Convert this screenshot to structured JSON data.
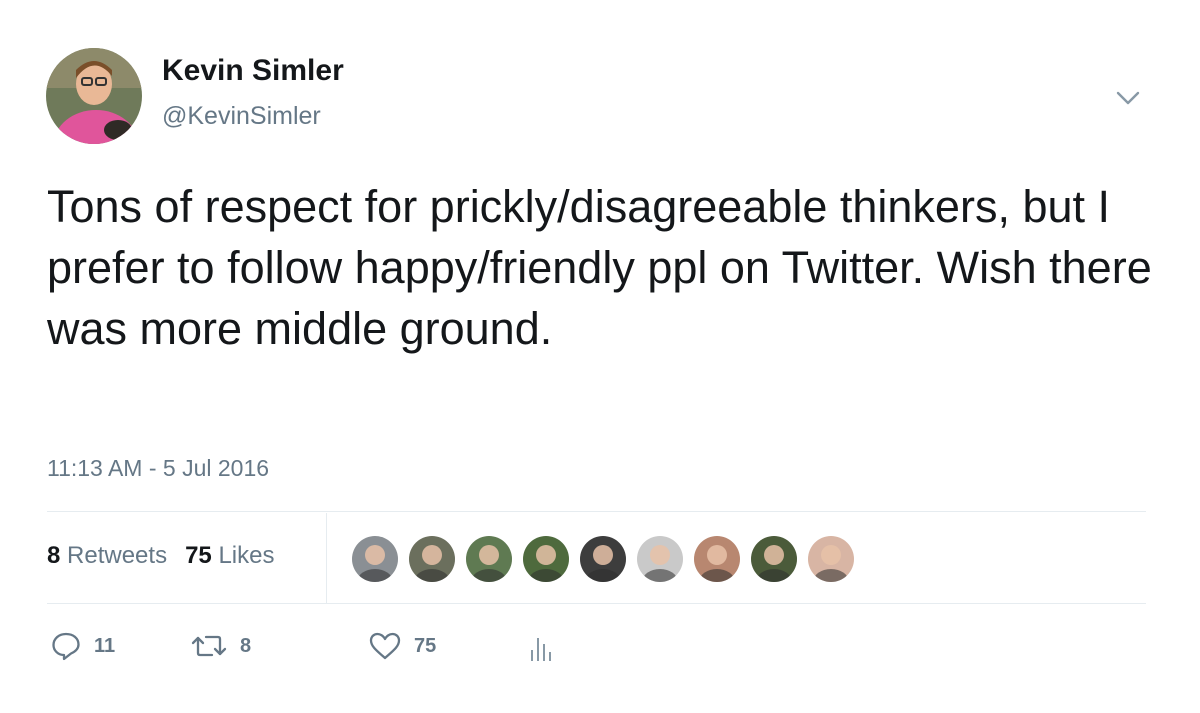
{
  "author": {
    "display_name": "Kevin Simler",
    "handle": "@KevinSimler",
    "avatar_icon": "profile-photo"
  },
  "tweet": {
    "text": "Tons of respect for prickly/disagreeable thinkers, but I prefer to follow happy/friendly ppl on Twitter. Wish there was more middle ground.",
    "timestamp": "11:13 AM - 5 Jul 2016"
  },
  "stats": {
    "retweets_count": "8",
    "retweets_label": "Retweets",
    "likes_count": "75",
    "likes_label": "Likes"
  },
  "likers": [
    {
      "name": "liker-1",
      "color": "#8a8f94"
    },
    {
      "name": "liker-2",
      "color": "#6b6f5d"
    },
    {
      "name": "liker-3",
      "color": "#5f7a52"
    },
    {
      "name": "liker-4",
      "color": "#4e6a3d"
    },
    {
      "name": "liker-5",
      "color": "#3d3d3d"
    },
    {
      "name": "liker-6",
      "color": "#c9c9c9"
    },
    {
      "name": "liker-7",
      "color": "#b88770"
    },
    {
      "name": "liker-8",
      "color": "#4b5b3a"
    },
    {
      "name": "liker-9",
      "color": "#d8b5a4"
    }
  ],
  "actions": {
    "reply_count": "11",
    "retweet_count": "8",
    "like_count": "75"
  },
  "colors": {
    "text": "#14171a",
    "secondary": "#657786",
    "divider": "#e6ecf0"
  }
}
